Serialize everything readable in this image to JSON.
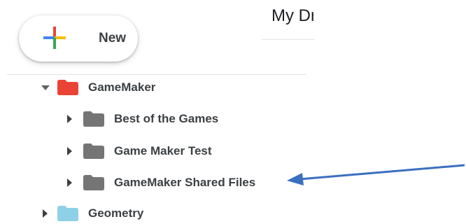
{
  "new_button": {
    "label": "New",
    "icon": "plus-icon"
  },
  "header": {
    "title": "My Dr"
  },
  "tree": [
    {
      "label": "GameMaker",
      "expanded": true,
      "folder_color": "#ea4335",
      "caret_icon": "caret-down-icon"
    },
    {
      "label": "Best of the Games",
      "expanded": false,
      "folder_color": "#757575",
      "caret_icon": "caret-right-icon"
    },
    {
      "label": "Game Maker Test",
      "expanded": false,
      "folder_color": "#757575",
      "caret_icon": "caret-right-icon"
    },
    {
      "label": "GameMaker Shared Files",
      "expanded": false,
      "folder_color": "#757575",
      "caret_icon": "caret-right-icon"
    },
    {
      "label": "Geometry",
      "expanded": false,
      "folder_color": "#8ed1e6",
      "caret_icon": "caret-right-icon"
    }
  ],
  "annotation": {
    "color": "#3b6fc0"
  }
}
